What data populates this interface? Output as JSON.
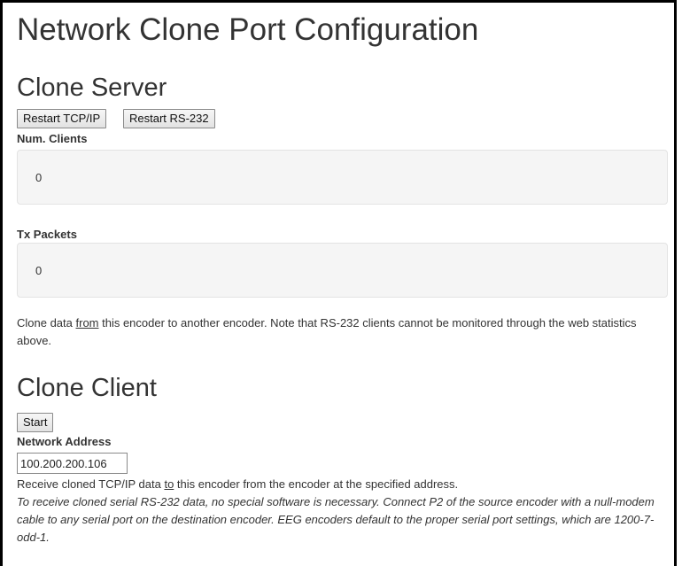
{
  "page_title": "Network Clone Port Configuration",
  "clone_server": {
    "heading": "Clone Server",
    "restart_tcpip_label": "Restart TCP/IP",
    "restart_rs232_label": "Restart RS-232",
    "num_clients_label": "Num. Clients",
    "num_clients_value": "0",
    "tx_packets_label": "Tx Packets",
    "tx_packets_value": "0",
    "note_before": "Clone data ",
    "note_emph": "from",
    "note_after": " this encoder to another encoder. Note that RS-232 clients cannot be monitored through the web statistics above."
  },
  "clone_client": {
    "heading": "Clone Client",
    "start_label": "Start",
    "network_address_label": "Network Address",
    "network_address_value": "100.200.200.106",
    "receive_before": "Receive cloned TCP/IP data ",
    "receive_emph": "to",
    "receive_after": " this encoder from the encoder at the specified address.",
    "serial_note": "To receive cloned serial RS-232 data, no special software is necessary. Connect P2 of the source encoder with a null-modem cable to any serial port on the destination encoder. EEG encoders default to the proper serial port settings, which are 1200-7-odd-1."
  }
}
